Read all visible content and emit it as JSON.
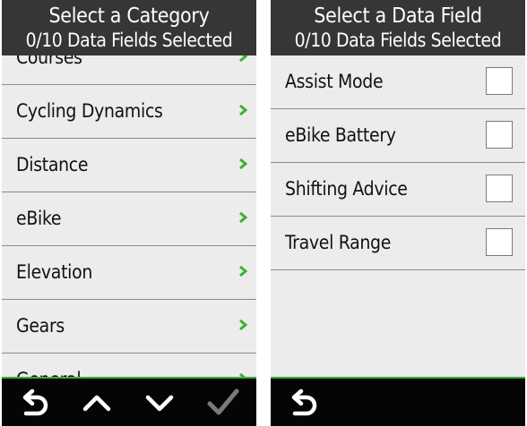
{
  "left": {
    "title": "Select a Category",
    "subtitle": "0/10 Data Fields Selected",
    "items": [
      {
        "label": "Courses"
      },
      {
        "label": "Cycling Dynamics"
      },
      {
        "label": "Distance"
      },
      {
        "label": "eBike"
      },
      {
        "label": "Elevation"
      },
      {
        "label": "Gears"
      },
      {
        "label": "General"
      }
    ]
  },
  "right": {
    "title": "Select a Data Field",
    "subtitle": "0/10 Data Fields Selected",
    "items": [
      {
        "label": "Assist Mode",
        "checked": false
      },
      {
        "label": "eBike Battery",
        "checked": false
      },
      {
        "label": "Shifting Advice",
        "checked": false
      },
      {
        "label": "Travel Range",
        "checked": false
      }
    ]
  },
  "icons": {
    "back": "back-arrow-icon",
    "up": "chevron-up-icon",
    "down": "chevron-down-icon",
    "confirm": "checkmark-icon",
    "row": "chevron-right-icon"
  },
  "colors": {
    "header_bg": "#363636",
    "list_bg": "#ececec",
    "accent_green": "#3fae36",
    "footer_bg": "#050505",
    "disabled_icon": "#7a7a7a"
  }
}
